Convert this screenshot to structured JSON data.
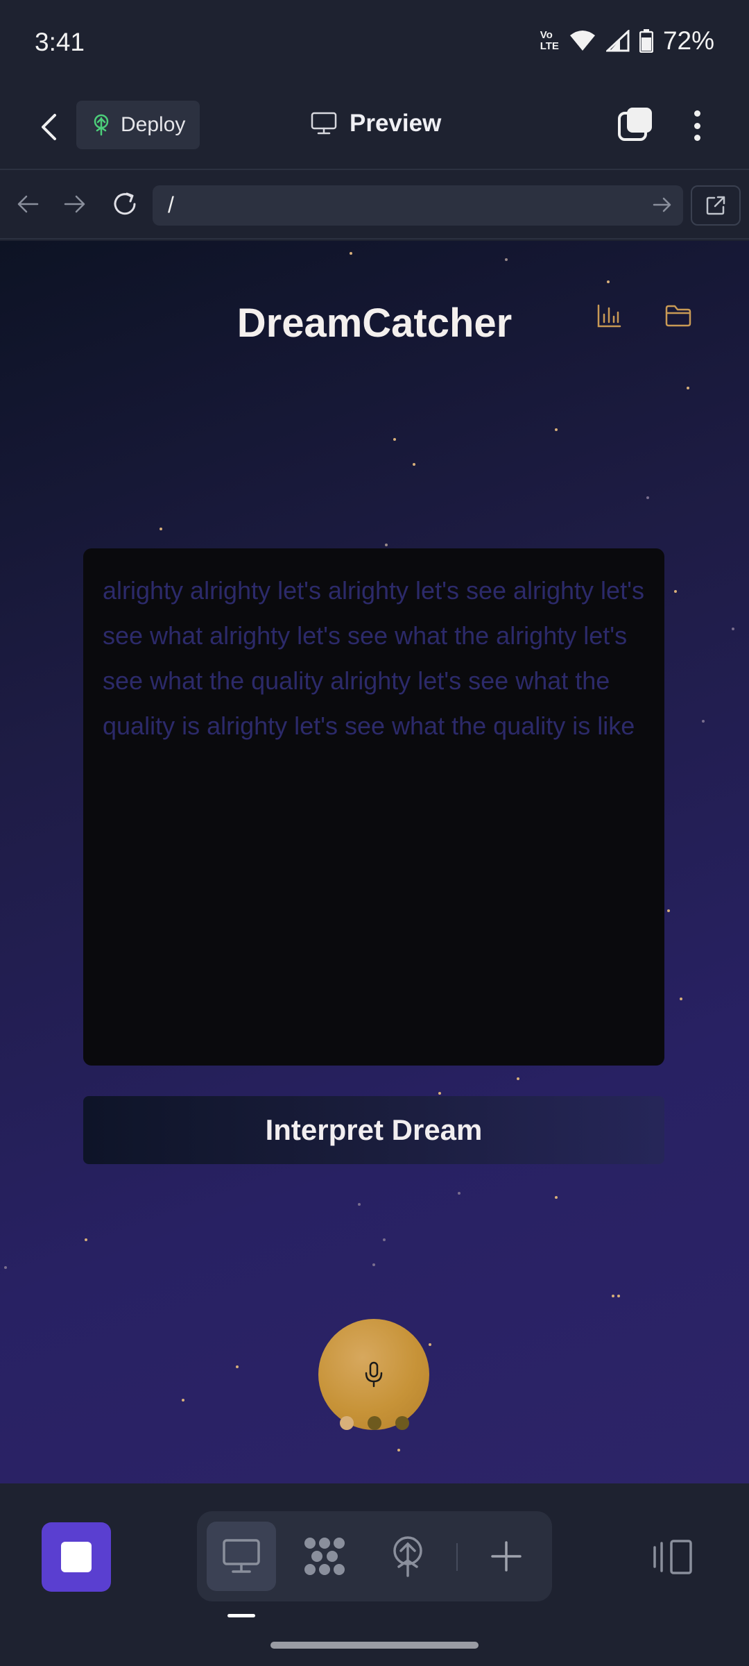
{
  "status_bar": {
    "time": "3:41",
    "network_label_top": "Vo",
    "network_label_bottom": "LTE",
    "battery_percent": "72%"
  },
  "app_bar": {
    "deploy_label": "Deploy",
    "preview_label": "Preview"
  },
  "browser": {
    "url": "/"
  },
  "web_app": {
    "title": "DreamCatcher",
    "dream_text": "alrighty alrighty let's alrighty let's see alrighty let's see what alrighty let's see what the alrighty let's see what the quality alrighty let's see what the quality is alrighty let's see what the quality is like",
    "interpret_button": "Interpret Dream",
    "recording_dots_colors": [
      "#d8b07a",
      "#6e5a1e",
      "#6e5a1e"
    ]
  },
  "colors": {
    "accent_gold": "#c79338",
    "accent_purple": "#5a3fd0",
    "deploy_icon_green": "#4ccf7a"
  }
}
